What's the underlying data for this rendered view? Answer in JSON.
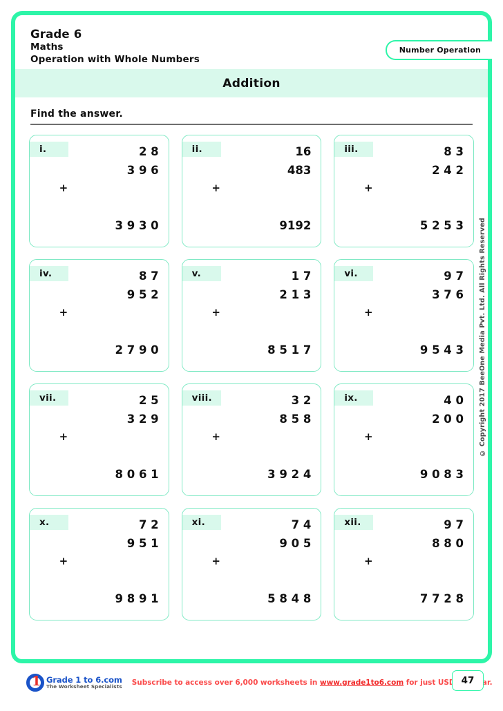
{
  "header": {
    "grade": "Grade 6",
    "subject": "Maths",
    "topic_line": "Operation with Whole Numbers",
    "badge": "Number Operation"
  },
  "title_band": {
    "title": "Addition"
  },
  "instruction": "Find the answer.",
  "problems": [
    {
      "label": "i.",
      "a": "2 8",
      "b": "3 9 6",
      "plus": "+",
      "c": "3 9 3 0"
    },
    {
      "label": "ii.",
      "a": "16",
      "b": "483",
      "plus": "+",
      "c": "9192"
    },
    {
      "label": "iii.",
      "a": "8 3",
      "b": "2 4 2",
      "plus": "+",
      "c": "5 2 5 3"
    },
    {
      "label": "iv.",
      "a": "8 7",
      "b": "9 5 2",
      "plus": "+",
      "c": "2 7 9 0"
    },
    {
      "label": "v.",
      "a": "1 7",
      "b": "2 1 3",
      "plus": "+",
      "c": "8 5 1 7"
    },
    {
      "label": "vi.",
      "a": "9 7",
      "b": "3 7 6",
      "plus": "+",
      "c": "9 5 4 3"
    },
    {
      "label": "vii.",
      "a": "2 5",
      "b": "3 2 9",
      "plus": "+",
      "c": "8 0 6 1"
    },
    {
      "label": "viii.",
      "a": "3 2",
      "b": "8 5 8",
      "plus": "+",
      "c": "3 9 2 4"
    },
    {
      "label": "ix.",
      "a": "4 0",
      "b": "2 0 0",
      "plus": "+",
      "c": "9 0 8 3"
    },
    {
      "label": "x.",
      "a": "7 2",
      "b": "9 5 1",
      "plus": "+",
      "c": "9 8 9 1"
    },
    {
      "label": "xi.",
      "a": "7 4",
      "b": "9 0 5",
      "plus": "+",
      "c": "5 8 4 8"
    },
    {
      "label": "xii.",
      "a": "9 7",
      "b": "8 8 0",
      "plus": "+",
      "c": "7 7 2 8"
    }
  ],
  "copyright": "© Copyright 2017 BeeOne Media Pvt. Ltd. All Rights Reserved",
  "footer": {
    "logo_title": "Grade 1 to 6.com",
    "logo_tagline": "The Worksheet Specialists",
    "logo_one": "1",
    "subscribe_prefix": "Subscribe to access over 6,000 worksheets in ",
    "subscribe_site": "www.grade1to6.com",
    "subscribe_suffix": " for just USD 25/ year.",
    "page_number": "47"
  },
  "colors": {
    "frame_green": "#2df5a8",
    "band_mint": "#d9f9ec",
    "card_border": "#7fe9c4",
    "logo_blue": "#1a53c8",
    "logo_red": "#e8302a",
    "subscribe_red": "#fa4b4b"
  }
}
